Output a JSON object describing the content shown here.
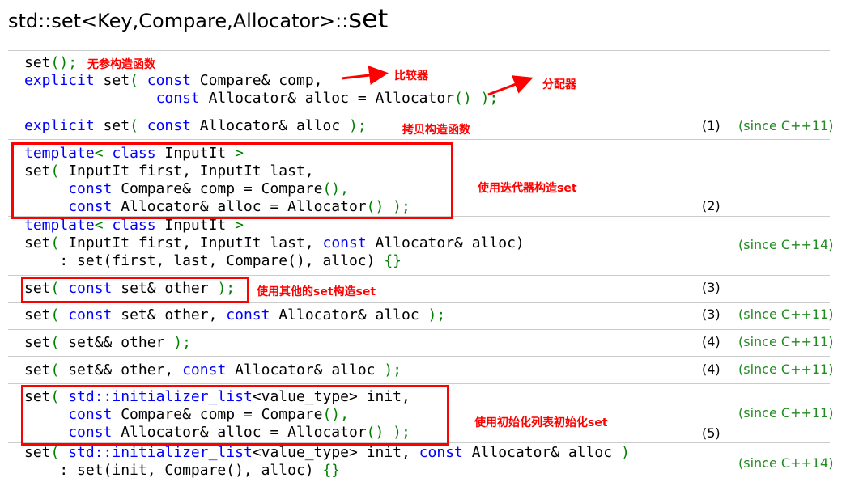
{
  "title": {
    "prefix": "std::set<Key,Compare,Allocator>::",
    "name": "set"
  },
  "overloads": [
    {
      "lines": [
        [
          [
            "g",
            "set"
          ],
          [
            "b",
            "();"
          ]
        ],
        [
          [
            "k",
            "explicit"
          ],
          [
            "g",
            " set"
          ],
          [
            "b",
            "( "
          ],
          [
            "k",
            "const"
          ],
          [
            "g",
            " Compare& comp,"
          ]
        ],
        [
          [
            "g",
            "               "
          ],
          [
            "k",
            "const"
          ],
          [
            "g",
            " Allocator& alloc = Allocator"
          ],
          [
            "b",
            "()"
          ],
          [
            "g",
            " "
          ],
          [
            "b",
            ");"
          ]
        ]
      ],
      "number": "",
      "since": ""
    },
    {
      "lines": [
        [
          [
            "k",
            "explicit"
          ],
          [
            "g",
            " set"
          ],
          [
            "b",
            "( "
          ],
          [
            "k",
            "const"
          ],
          [
            "g",
            " Allocator& alloc "
          ],
          [
            "b",
            ");"
          ]
        ]
      ],
      "number": "(1)",
      "since": "(since C++11)"
    },
    {
      "lines": [
        [
          [
            "k",
            "template"
          ],
          [
            "b",
            "< "
          ],
          [
            "k",
            "class"
          ],
          [
            "g",
            " InputIt "
          ],
          [
            "b",
            ">"
          ]
        ],
        [
          [
            "g",
            "set"
          ],
          [
            "b",
            "( "
          ],
          [
            "g",
            "InputIt first, InputIt last,"
          ]
        ],
        [
          [
            "g",
            "     "
          ],
          [
            "k",
            "const"
          ],
          [
            "g",
            " Compare& comp = Compare"
          ],
          [
            "b",
            "(),"
          ]
        ],
        [
          [
            "g",
            "     "
          ],
          [
            "k",
            "const"
          ],
          [
            "g",
            " Allocator& alloc = Allocator"
          ],
          [
            "b",
            "() );"
          ]
        ]
      ],
      "number": "(2)",
      "since": ""
    },
    {
      "lines": [
        [
          [
            "k",
            "template"
          ],
          [
            "b",
            "< "
          ],
          [
            "k",
            "class"
          ],
          [
            "g",
            " InputIt "
          ],
          [
            "b",
            ">"
          ]
        ],
        [
          [
            "g",
            "set"
          ],
          [
            "b",
            "( "
          ],
          [
            "g",
            "InputIt first, InputIt last, "
          ],
          [
            "k",
            "const"
          ],
          [
            "g",
            " Allocator& alloc)"
          ]
        ],
        [
          [
            "g",
            "    : set(first, last, Compare(), alloc) "
          ],
          [
            "r",
            "{}"
          ]
        ]
      ],
      "number": "",
      "since": "(since C++14)"
    },
    {
      "lines": [
        [
          [
            "g",
            "set"
          ],
          [
            "b",
            "( "
          ],
          [
            "k",
            "const"
          ],
          [
            "g",
            " set& other "
          ],
          [
            "b",
            ");"
          ]
        ]
      ],
      "number": "(3)",
      "since": ""
    },
    {
      "lines": [
        [
          [
            "g",
            "set"
          ],
          [
            "b",
            "( "
          ],
          [
            "k",
            "const"
          ],
          [
            "g",
            " set& other, "
          ],
          [
            "k",
            "const"
          ],
          [
            "g",
            " Allocator& alloc "
          ],
          [
            "b",
            ");"
          ]
        ]
      ],
      "number": "(3)",
      "since": "(since C++11)"
    },
    {
      "lines": [
        [
          [
            "g",
            "set"
          ],
          [
            "b",
            "( "
          ],
          [
            "g",
            "set&& other "
          ],
          [
            "b",
            ");"
          ]
        ]
      ],
      "number": "(4)",
      "since": "(since C++11)"
    },
    {
      "lines": [
        [
          [
            "g",
            "set"
          ],
          [
            "b",
            "( "
          ],
          [
            "g",
            "set&& other, "
          ],
          [
            "k",
            "const"
          ],
          [
            "g",
            " Allocator& alloc "
          ],
          [
            "b",
            ");"
          ]
        ]
      ],
      "number": "(4)",
      "since": "(since C++11)"
    },
    {
      "lines": [
        [
          [
            "g",
            "set"
          ],
          [
            "b",
            "( "
          ],
          [
            "k",
            "std::initializer_list"
          ],
          [
            "g",
            "<value_type> init,"
          ]
        ],
        [
          [
            "g",
            "     "
          ],
          [
            "k",
            "const"
          ],
          [
            "g",
            " Compare& comp = Compare"
          ],
          [
            "b",
            "(),"
          ]
        ],
        [
          [
            "g",
            "     "
          ],
          [
            "k",
            "const"
          ],
          [
            "g",
            " Allocator& alloc = Allocator"
          ],
          [
            "b",
            "() );"
          ]
        ]
      ],
      "number": "(5)",
      "since": "(since C++11)"
    },
    {
      "lines": [
        [
          [
            "g",
            "set"
          ],
          [
            "b",
            "( "
          ],
          [
            "k",
            "std::initializer_list"
          ],
          [
            "g",
            "<value_type> init, "
          ],
          [
            "k",
            "const"
          ],
          [
            "g",
            " Allocator& alloc "
          ],
          [
            "b",
            ")"
          ]
        ],
        [
          [
            "g",
            "    : set(init, Compare(), alloc) "
          ],
          [
            "r",
            "{}"
          ]
        ]
      ],
      "number": "",
      "since": "(since C++14)"
    }
  ],
  "annotations": {
    "default_ctor": "无参构造函数",
    "comparator": "比较器",
    "allocator": "分配器",
    "copy_ctor": "拷贝构造函数",
    "iterator_ctor": "使用迭代器构造set",
    "other_set_ctor": "使用其他的set构造set",
    "init_list_ctor": "使用初始化列表初始化set"
  },
  "colors": {
    "keyword": "#0000ff",
    "punctuation": "#008000",
    "since_text": "#228b22",
    "annotation": "#ff0000",
    "divider": "#cccccc"
  }
}
